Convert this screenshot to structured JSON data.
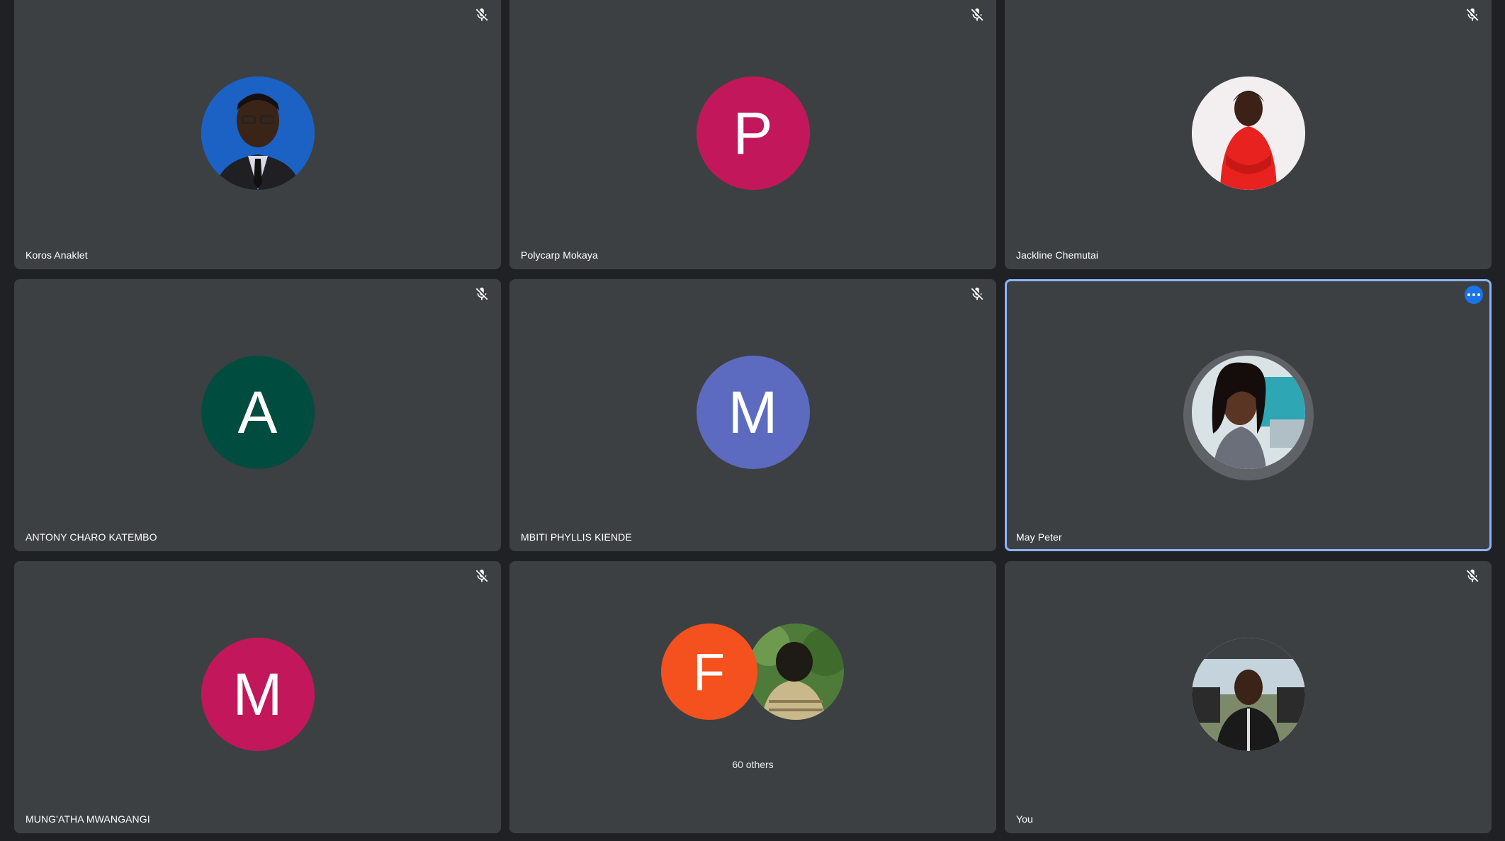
{
  "participants": [
    {
      "name": "Koros Anaklet",
      "avatar_type": "photo",
      "muted": true
    },
    {
      "name": "Polycarp Mokaya",
      "avatar_type": "initial",
      "initial": "P",
      "color": "#c2185b",
      "muted": true
    },
    {
      "name": "Jackline Chemutai",
      "avatar_type": "photo",
      "muted": true
    },
    {
      "name": "ANTONY CHARO KATEMBO",
      "avatar_type": "initial",
      "initial": "A",
      "color": "#004d40",
      "muted": true
    },
    {
      "name": "MBITI PHYLLIS KIENDE",
      "avatar_type": "initial",
      "initial": "M",
      "color": "#5c6bc0",
      "muted": true
    },
    {
      "name": "May Peter",
      "avatar_type": "photo",
      "muted": false,
      "speaking": true,
      "menu_icon": "more-horiz-icon"
    },
    {
      "name": "MUNG'ATHA MWANGANGI",
      "avatar_type": "initial",
      "initial": "M",
      "color": "#c2185b",
      "muted": true
    },
    {
      "name": "",
      "avatar_type": "group",
      "initial": "F",
      "color": "#f4511e",
      "others_label": "60 others",
      "muted": false
    },
    {
      "name": "You",
      "avatar_type": "photo",
      "muted": true
    }
  ],
  "colors": {
    "background": "#202124",
    "tile": "#3c4043",
    "active_border": "#8ab4f8",
    "menu_button": "#1a73e8"
  },
  "icons": {
    "mute": "mic-off-icon"
  }
}
